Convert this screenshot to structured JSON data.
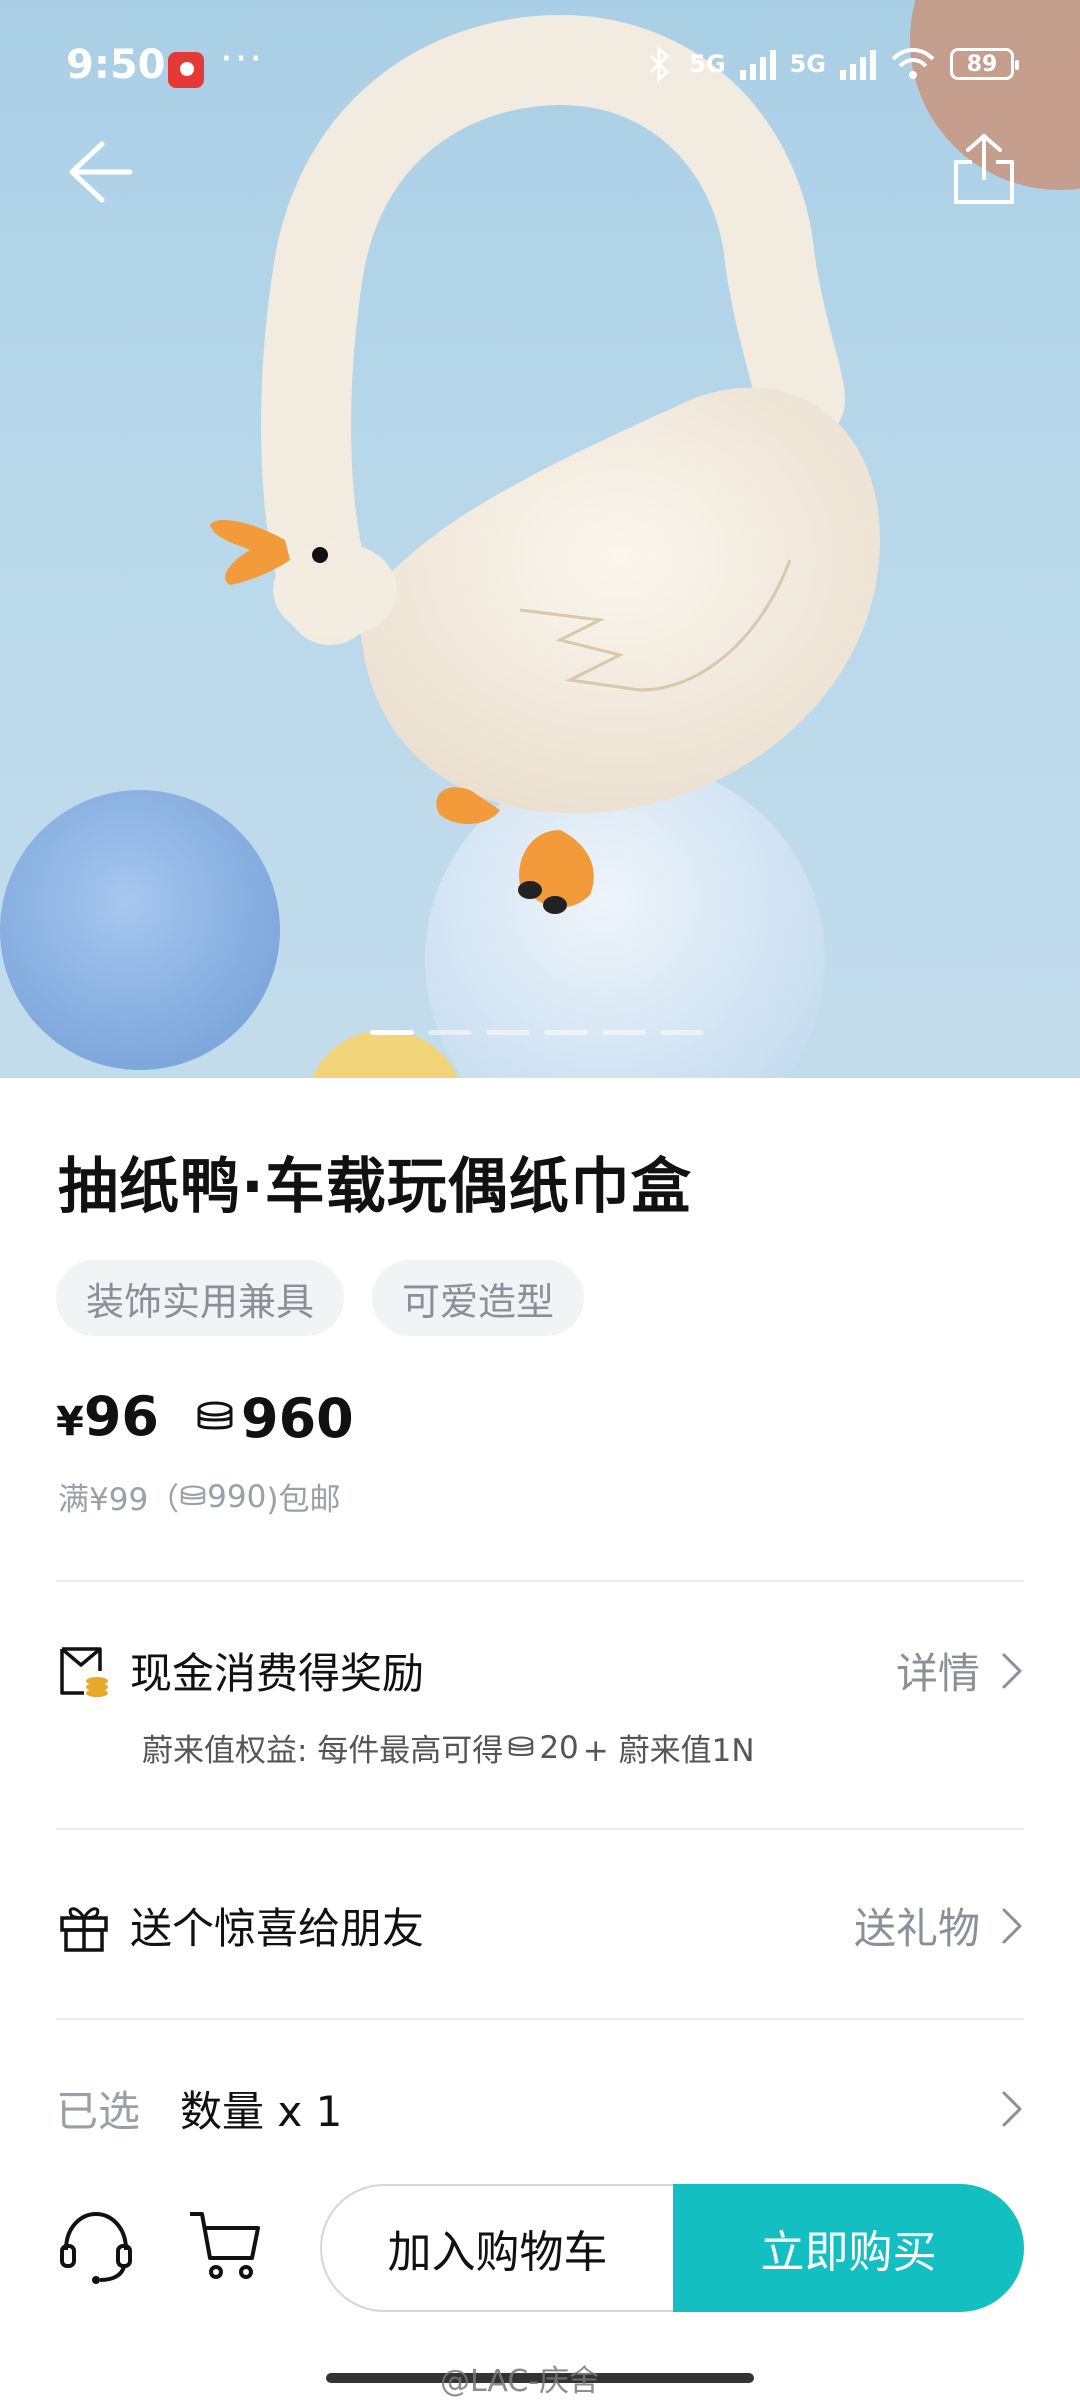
{
  "status_bar": {
    "time": "9:50",
    "more": "···",
    "signal_1": "5G",
    "signal_2": "5G",
    "battery": "89"
  },
  "hero": {
    "pager_total": 6,
    "pager_active": 0
  },
  "product": {
    "title": "抽纸鸭·车载玩偶纸巾盒",
    "tags": [
      "装饰实用兼具",
      "可爱造型"
    ],
    "price_symbol": "¥",
    "price": "96",
    "points": "960",
    "shipping_prefix": "满¥99（",
    "shipping_points": "990",
    "shipping_suffix": ")包邮"
  },
  "reward": {
    "label": "现金消费得奖励",
    "action": "详情",
    "sub_prefix": "蔚来值权益:  每件最高可得",
    "sub_points": "20",
    "sub_suffix": " + 蔚来值1N"
  },
  "gift": {
    "label": "送个惊喜给朋友",
    "action": "送礼物"
  },
  "selection": {
    "label": "已选",
    "value": "数量 x 1"
  },
  "bottom_bar": {
    "add_to_cart": "加入购物车",
    "buy_now": "立即购买"
  },
  "watermark": "@LAC-庆舍",
  "colors": {
    "accent": "#14bfc1",
    "sky": "#a9cfe6"
  },
  "icons": {
    "back": "arrow-left-icon",
    "share": "share-icon",
    "reward": "coupon-coin-icon",
    "gift": "gift-icon",
    "service": "headset-icon",
    "cart": "cart-icon"
  }
}
